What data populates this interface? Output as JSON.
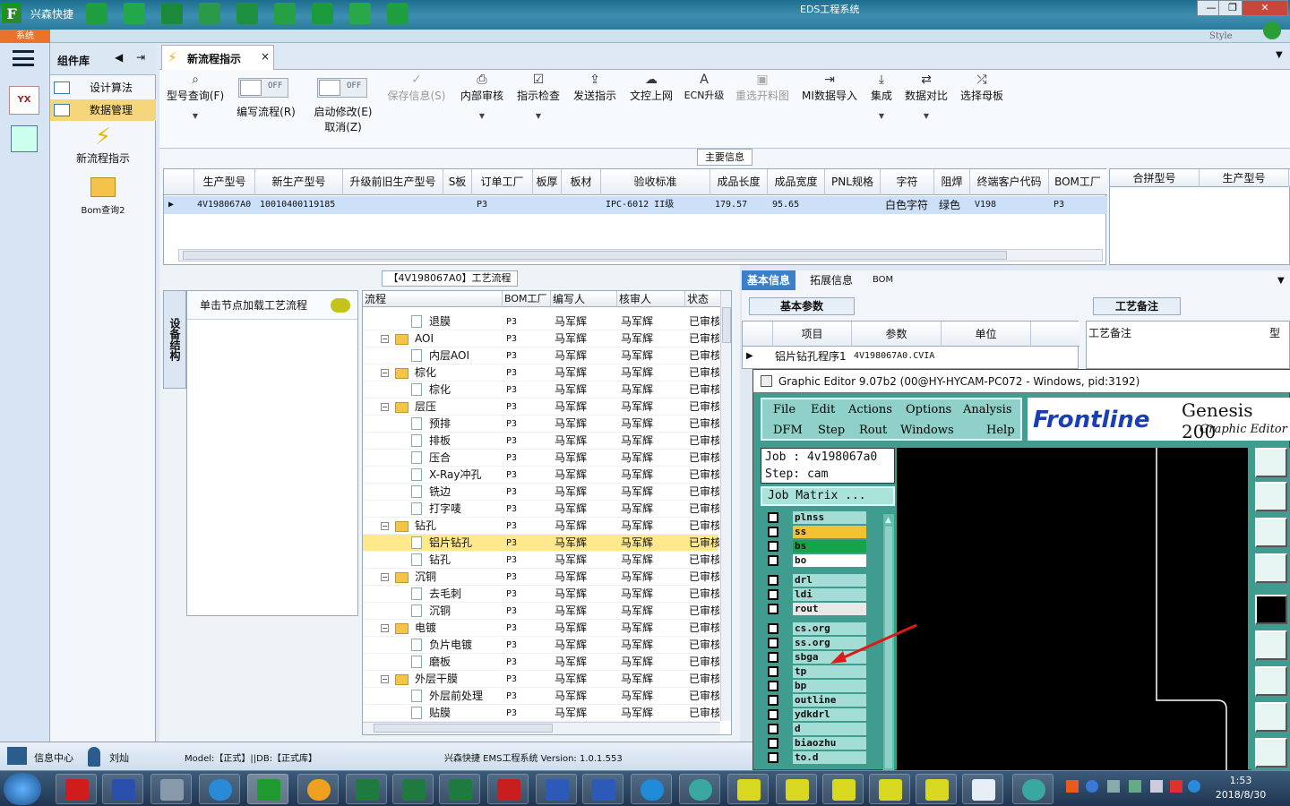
{
  "app": {
    "name": "兴森快捷",
    "window_title": "EDS工程系统",
    "system_label": "系统",
    "style_label": "Style"
  },
  "window_controls": {
    "minimize": "—",
    "restore": "❐",
    "close": "✕"
  },
  "sidebar": {
    "header": "组件库",
    "items": [
      {
        "label": "设计算法"
      },
      {
        "label": "数据管理"
      }
    ],
    "tools": [
      {
        "label": "新流程指示"
      },
      {
        "label": "Bom查询2"
      }
    ]
  },
  "tab": {
    "label": "新流程指示",
    "close": "×"
  },
  "toolbar": {
    "model_query": "型号查询(F)",
    "edit_flow": "编写流程(R)",
    "start_modify": "启动修改(E)",
    "cancel": "取消(Z)",
    "switch_text": "OFF",
    "save_info": "保存信息(S)",
    "internal_review": "内部审核",
    "instruction_check": "指示检查",
    "send_instruction": "发送指示",
    "doc_upload": "文控上网",
    "ecn_upgrade": "ECN升级",
    "reselect_layout": "重选开料图",
    "mi_import": "MI数据导入",
    "integrate": "集成",
    "data_compare": "数据对比",
    "select_panel": "选择母板"
  },
  "main_info": {
    "title": "主要信息",
    "columns": [
      "生产型号",
      "新生产型号",
      "升级前旧生产型号",
      "S板",
      "订单工厂",
      "板厚",
      "板材",
      "验收标准",
      "成品长度",
      "成品宽度",
      "PNL规格",
      "字符",
      "阻焊",
      "终端客户代码",
      "BOM工厂"
    ],
    "row": [
      "4V198067A0",
      "10010400119185",
      "",
      "",
      "P3",
      "",
      "",
      "IPC-6012 II级",
      "179.57",
      "95.65",
      "",
      "白色字符",
      "绿色",
      "V198",
      "P3"
    ],
    "right_columns": [
      "合拼型号",
      "生产型号"
    ]
  },
  "process": {
    "title": "【4V198067A0】工艺流程",
    "vertical_tab": "设备结构",
    "hint": "单击节点加载工艺流程",
    "columns": [
      "流程",
      "BOM工厂",
      "编写人",
      "核审人",
      "状态"
    ],
    "rows": [
      {
        "name": "退膜",
        "level": 2,
        "bom": "P3",
        "author": "马军辉",
        "reviewer": "马军辉",
        "status": "已审核"
      },
      {
        "name": "AOI",
        "level": 1,
        "bom": "P3",
        "author": "马军辉",
        "reviewer": "马军辉",
        "status": "已审核"
      },
      {
        "name": "内层AOI",
        "level": 2,
        "bom": "P3",
        "author": "马军辉",
        "reviewer": "马军辉",
        "status": "已审核"
      },
      {
        "name": "棕化",
        "level": 1,
        "bom": "P3",
        "author": "马军辉",
        "reviewer": "马军辉",
        "status": "已审核"
      },
      {
        "name": "棕化",
        "level": 2,
        "bom": "P3",
        "author": "马军辉",
        "reviewer": "马军辉",
        "status": "已审核"
      },
      {
        "name": "层压",
        "level": 1,
        "bom": "P3",
        "author": "马军辉",
        "reviewer": "马军辉",
        "status": "已审核"
      },
      {
        "name": "预排",
        "level": 2,
        "bom": "P3",
        "author": "马军辉",
        "reviewer": "马军辉",
        "status": "已审核"
      },
      {
        "name": "排板",
        "level": 2,
        "bom": "P3",
        "author": "马军辉",
        "reviewer": "马军辉",
        "status": "已审核"
      },
      {
        "name": "压合",
        "level": 2,
        "bom": "P3",
        "author": "马军辉",
        "reviewer": "马军辉",
        "status": "已审核"
      },
      {
        "name": "X-Ray冲孔",
        "level": 2,
        "bom": "P3",
        "author": "马军辉",
        "reviewer": "马军辉",
        "status": "已审核"
      },
      {
        "name": "铣边",
        "level": 2,
        "bom": "P3",
        "author": "马军辉",
        "reviewer": "马军辉",
        "status": "已审核"
      },
      {
        "name": "打字唛",
        "level": 2,
        "bom": "P3",
        "author": "马军辉",
        "reviewer": "马军辉",
        "status": "已审核"
      },
      {
        "name": "钻孔",
        "level": 1,
        "bom": "P3",
        "author": "马军辉",
        "reviewer": "马军辉",
        "status": "已审核"
      },
      {
        "name": "铝片钻孔",
        "level": 2,
        "bom": "P3",
        "author": "马军辉",
        "reviewer": "马军辉",
        "status": "已审核",
        "selected": true
      },
      {
        "name": "钻孔",
        "level": 2,
        "bom": "P3",
        "author": "马军辉",
        "reviewer": "马军辉",
        "status": "已审核"
      },
      {
        "name": "沉铜",
        "level": 1,
        "bom": "P3",
        "author": "马军辉",
        "reviewer": "马军辉",
        "status": "已审核"
      },
      {
        "name": "去毛刺",
        "level": 2,
        "bom": "P3",
        "author": "马军辉",
        "reviewer": "马军辉",
        "status": "已审核"
      },
      {
        "name": "沉铜",
        "level": 2,
        "bom": "P3",
        "author": "马军辉",
        "reviewer": "马军辉",
        "status": "已审核"
      },
      {
        "name": "电镀",
        "level": 1,
        "bom": "P3",
        "author": "马军辉",
        "reviewer": "马军辉",
        "status": "已审核"
      },
      {
        "name": "负片电镀",
        "level": 2,
        "bom": "P3",
        "author": "马军辉",
        "reviewer": "马军辉",
        "status": "已审核"
      },
      {
        "name": "磨板",
        "level": 2,
        "bom": "P3",
        "author": "马军辉",
        "reviewer": "马军辉",
        "status": "已审核"
      },
      {
        "name": "外层干膜",
        "level": 1,
        "bom": "P3",
        "author": "马军辉",
        "reviewer": "马军辉",
        "status": "已审核"
      },
      {
        "name": "外层前处理",
        "level": 2,
        "bom": "P3",
        "author": "马军辉",
        "reviewer": "马军辉",
        "status": "已审核"
      },
      {
        "name": "贴膜",
        "level": 2,
        "bom": "P3",
        "author": "马军辉",
        "reviewer": "马军辉",
        "status": "已审核"
      }
    ]
  },
  "detail": {
    "tabs": [
      "基本信息",
      "拓展信息",
      "BOM"
    ],
    "sub_basic": "基本参数",
    "columns": [
      "项目",
      "参数",
      "单位"
    ],
    "row": [
      "铝片钻孔程序1",
      "4V198067A0.CVIA",
      ""
    ],
    "remark_tab": "工艺备注",
    "remark_col": "工艺备注",
    "remark_col2": "型"
  },
  "genesis": {
    "title": "Graphic Editor 9.07b2 (00@HY-HYCAM-PC072 - Windows, pid:3192)",
    "menu": [
      "File",
      "Edit",
      "Actions",
      "Options",
      "Analysis",
      "DFM",
      "Step",
      "Rout",
      "Windows",
      "Help"
    ],
    "logo": "Frontline",
    "product": "Genesis 200",
    "product_sub": "Graphic Editor",
    "job": "Job : 4v198067a0",
    "step": "Step: cam",
    "matrix_button": "Job Matrix ...",
    "layers": [
      {
        "name": "plnss",
        "color": "#a3ddd5"
      },
      {
        "name": "ss",
        "color": "#f2c230"
      },
      {
        "name": "bs",
        "color": "#16a34a"
      },
      {
        "name": "bo",
        "color": "#ffffff"
      },
      {
        "name": "drl",
        "color": "#a3ddd5"
      },
      {
        "name": "ldi",
        "color": "#a3ddd5"
      },
      {
        "name": "rout",
        "color": "#e8e8e8"
      },
      {
        "name": "cs.org",
        "color": "#a3ddd5"
      },
      {
        "name": "ss.org",
        "color": "#a3ddd5"
      },
      {
        "name": "sbga",
        "color": "#a3ddd5"
      },
      {
        "name": "tp",
        "color": "#a3ddd5"
      },
      {
        "name": "bp",
        "color": "#a3ddd5"
      },
      {
        "name": "outline",
        "color": "#a3ddd5"
      },
      {
        "name": "ydkdrl",
        "color": "#a3ddd5"
      },
      {
        "name": "d",
        "color": "#a3ddd5"
      },
      {
        "name": "biaozhu",
        "color": "#a3ddd5"
      },
      {
        "name": "to.d",
        "color": "#a3ddd5"
      }
    ]
  },
  "status": {
    "info_center": "信息中心",
    "user": "刘灿",
    "model": "Model:【正式】||DB:【正式库】",
    "version": "兴森快捷 EMS工程系统 Version: 1.0.1.553"
  },
  "clock": {
    "time": "1:53",
    "date": "2018/8/30"
  },
  "colors": {
    "accent": "#3a7fc7",
    "selection": "#ffe98a",
    "genesis_bg": "#3f9c8e"
  }
}
